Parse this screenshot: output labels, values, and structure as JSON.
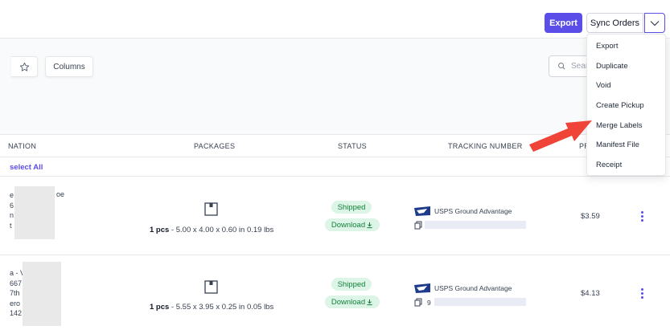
{
  "header": {
    "export_label": "Export",
    "sync_label": "Sync Orders"
  },
  "toolbar": {
    "columns_label": "Columns",
    "search_placeholder": "Sear"
  },
  "table": {
    "headers": {
      "destination": "NATION",
      "packages": "PACKAGES",
      "status": "STATUS",
      "tracking": "TRACKING NUMBER",
      "price": "PR"
    },
    "select_all": "select All",
    "rows": [
      {
        "dest_lines": [
          "e",
          "6",
          "n",
          "t"
        ],
        "dest_tail": "oe",
        "pkg_qty": "1 pcs",
        "pkg_dims": " - 5.00 x 4.00 x 0.60 in  0.19 lbs",
        "status": "Shipped",
        "download": "Download",
        "carrier": "USPS Ground Advantage",
        "price": "$3.59"
      },
      {
        "dest_lines": [
          "a - V",
          "667",
          "7th",
          "ero",
          "142"
        ],
        "dest_tail": "",
        "pkg_qty": "1 pcs",
        "pkg_dims": " - 5.55 x 3.95 x 0.25 in  0.05 lbs",
        "status": "Shipped",
        "download": "Download",
        "carrier": "USPS Ground Advantage",
        "tracking_prefix": "9",
        "price": "$4.13"
      }
    ]
  },
  "menu": {
    "items": [
      "Export",
      "Duplicate",
      "Void",
      "Create Pickup",
      "Merge Labels",
      "Manifest File",
      "Receipt"
    ]
  },
  "colors": {
    "accent": "#5b4de8",
    "success_bg": "#dcf5e7",
    "success_text": "#15803d",
    "arrow": "#f04438"
  },
  "icons": [
    "chevron-down-icon",
    "star-icon",
    "search-icon",
    "package-icon",
    "download-icon",
    "usps-eagle-icon",
    "copy-icon",
    "kebab-icon",
    "pointer-arrow-icon"
  ]
}
